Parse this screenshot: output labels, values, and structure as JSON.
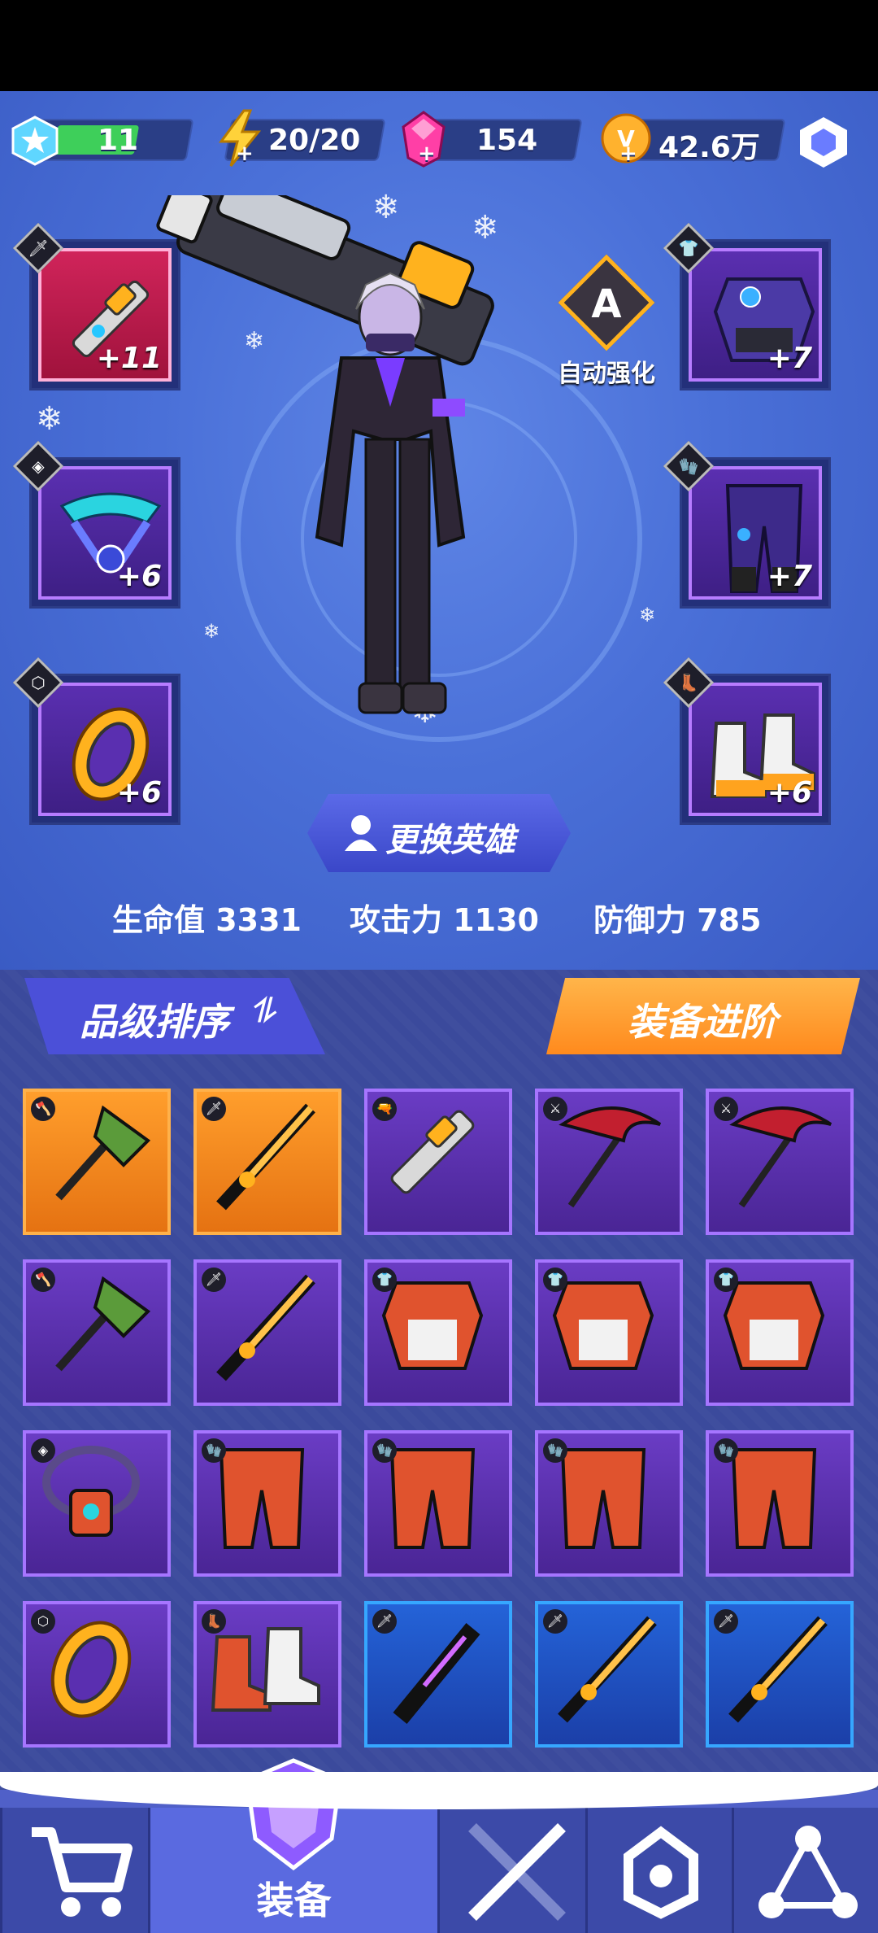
{
  "hud": {
    "level": "11",
    "energy": "20/20",
    "gems": "154",
    "gold": "42.6万"
  },
  "auto_enhance": {
    "badge": "A",
    "label": "自动强化"
  },
  "slots": {
    "weapon_plus": "+11",
    "necklace_plus": "+6",
    "ring_plus": "+6",
    "armor_plus": "+7",
    "pants_plus": "+7",
    "boots_plus": "+6"
  },
  "change_hero": "更换英雄",
  "stats": {
    "hp": "生命值 3331",
    "atk": "攻击力 1130",
    "def": "防御力 785"
  },
  "tabs": {
    "sort": "品级排序",
    "upgrade": "装备进阶"
  },
  "inventory": [
    {
      "type": "axe",
      "rarity": "orange"
    },
    {
      "type": "sword",
      "rarity": "orange"
    },
    {
      "type": "gun",
      "rarity": "purple"
    },
    {
      "type": "scythe",
      "rarity": "purple"
    },
    {
      "type": "scythe",
      "rarity": "purple"
    },
    {
      "type": "axe",
      "rarity": "purple"
    },
    {
      "type": "sword",
      "rarity": "purple"
    },
    {
      "type": "armor",
      "rarity": "purple"
    },
    {
      "type": "armor",
      "rarity": "purple"
    },
    {
      "type": "armor",
      "rarity": "purple"
    },
    {
      "type": "necklace",
      "rarity": "purple"
    },
    {
      "type": "pants",
      "rarity": "purple"
    },
    {
      "type": "pants",
      "rarity": "purple"
    },
    {
      "type": "pants",
      "rarity": "purple"
    },
    {
      "type": "pants",
      "rarity": "purple"
    },
    {
      "type": "ring",
      "rarity": "purple"
    },
    {
      "type": "boots",
      "rarity": "purple"
    },
    {
      "type": "blade",
      "rarity": "blue"
    },
    {
      "type": "sword",
      "rarity": "blue"
    },
    {
      "type": "sword",
      "rarity": "blue"
    }
  ],
  "nav": {
    "equip": "装备"
  },
  "colors": {
    "purple": "#a675ff",
    "orange": "#ffb14a",
    "blue": "#36a7ff"
  }
}
